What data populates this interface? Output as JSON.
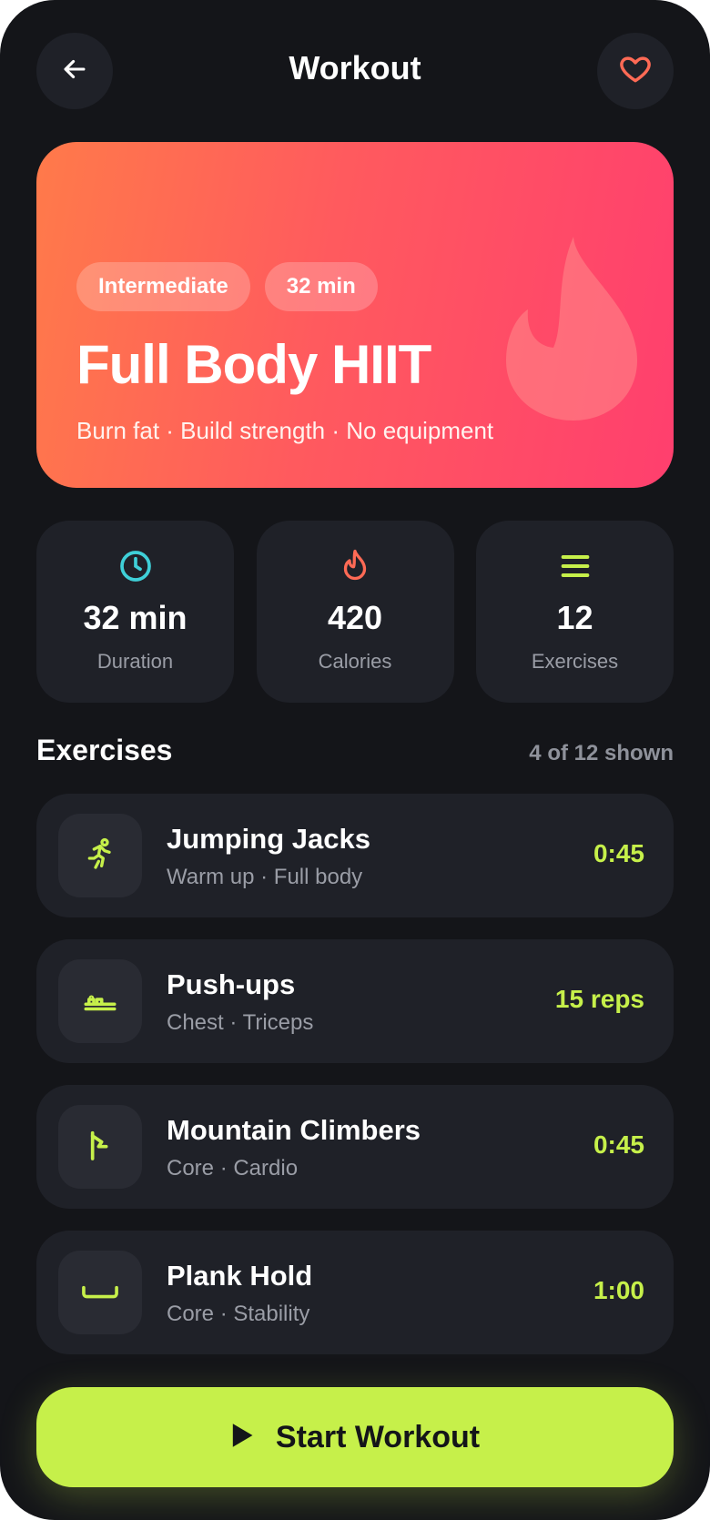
{
  "header": {
    "title": "Workout",
    "back_icon": "arrow-left-icon",
    "favorite_icon": "heart-icon"
  },
  "hero": {
    "chips": [
      "Intermediate",
      "32 min"
    ],
    "title": "Full Body HIIT",
    "subtitle": "Burn fat · Build strength · No equipment",
    "decor_icon": "flame-icon"
  },
  "stats": [
    {
      "value": "32 min",
      "label": "Duration",
      "icon": "clock-icon"
    },
    {
      "value": "420",
      "label": "Calories",
      "icon": "flame-icon"
    },
    {
      "value": "12",
      "label": "Exercises",
      "icon": "list-icon"
    }
  ],
  "exercises_section": {
    "title": "Exercises",
    "meta": "4 of 12 shown",
    "items": [
      {
        "name": "Jumping Jacks",
        "sub": "Warm up · Full body",
        "value": "0:45",
        "icon": "running-icon"
      },
      {
        "name": "Push-ups",
        "sub": "Chest · Triceps",
        "value": "15 reps",
        "icon": "pushup-icon"
      },
      {
        "name": "Mountain Climbers",
        "sub": "Core · Cardio",
        "value": "0:45",
        "icon": "climber-icon"
      },
      {
        "name": "Plank Hold",
        "sub": "Core · Stability",
        "value": "1:00",
        "icon": "plank-icon"
      }
    ]
  },
  "cta": {
    "label": "Start Workout",
    "icon": "play-icon"
  },
  "colors": {
    "background": "#141519",
    "card": "#1f2128",
    "accent": "#c6f04a",
    "hero_start": "#ff7a4a",
    "hero_end": "#ff3f6e",
    "teal": "#3fd0d8",
    "coral": "#ff6a55"
  }
}
